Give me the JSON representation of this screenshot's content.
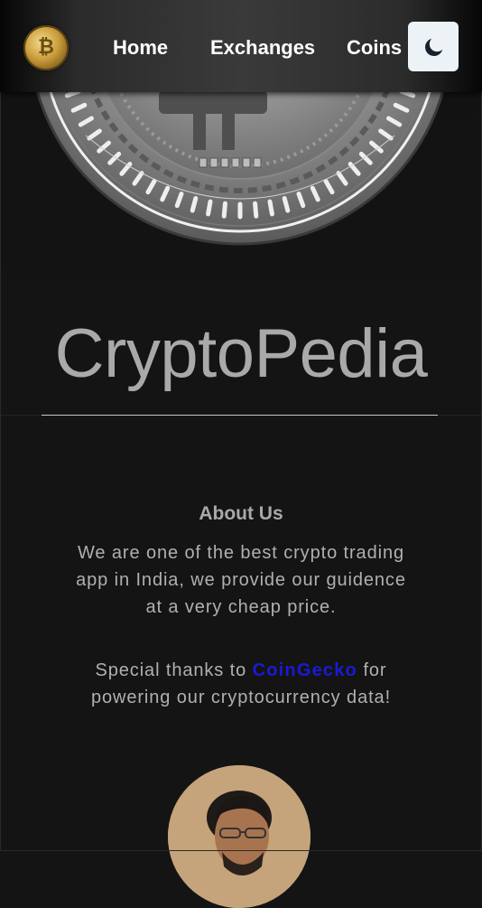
{
  "nav": {
    "links": [
      "Home",
      "Exchanges",
      "Coins"
    ],
    "theme_toggle_icon": "moon-icon",
    "logo_icon": "bitcoin-icon"
  },
  "hero": {
    "title": "CryptoPedia",
    "image_icon": "bitcoin-coin-image"
  },
  "about": {
    "heading": "About Us",
    "paragraph1": "We are one of the best crypto trading app in India, we provide our guidence at a very cheap price.",
    "thanks_prefix": "Special thanks to ",
    "thanks_link": "CoinGecko",
    "thanks_suffix": " for powering our cryptocurrency data!"
  },
  "colors": {
    "background": "#141414",
    "title_text": "#a9a9a9",
    "link": "#1a1ad6",
    "toggle_bg": "#edf2f7"
  }
}
